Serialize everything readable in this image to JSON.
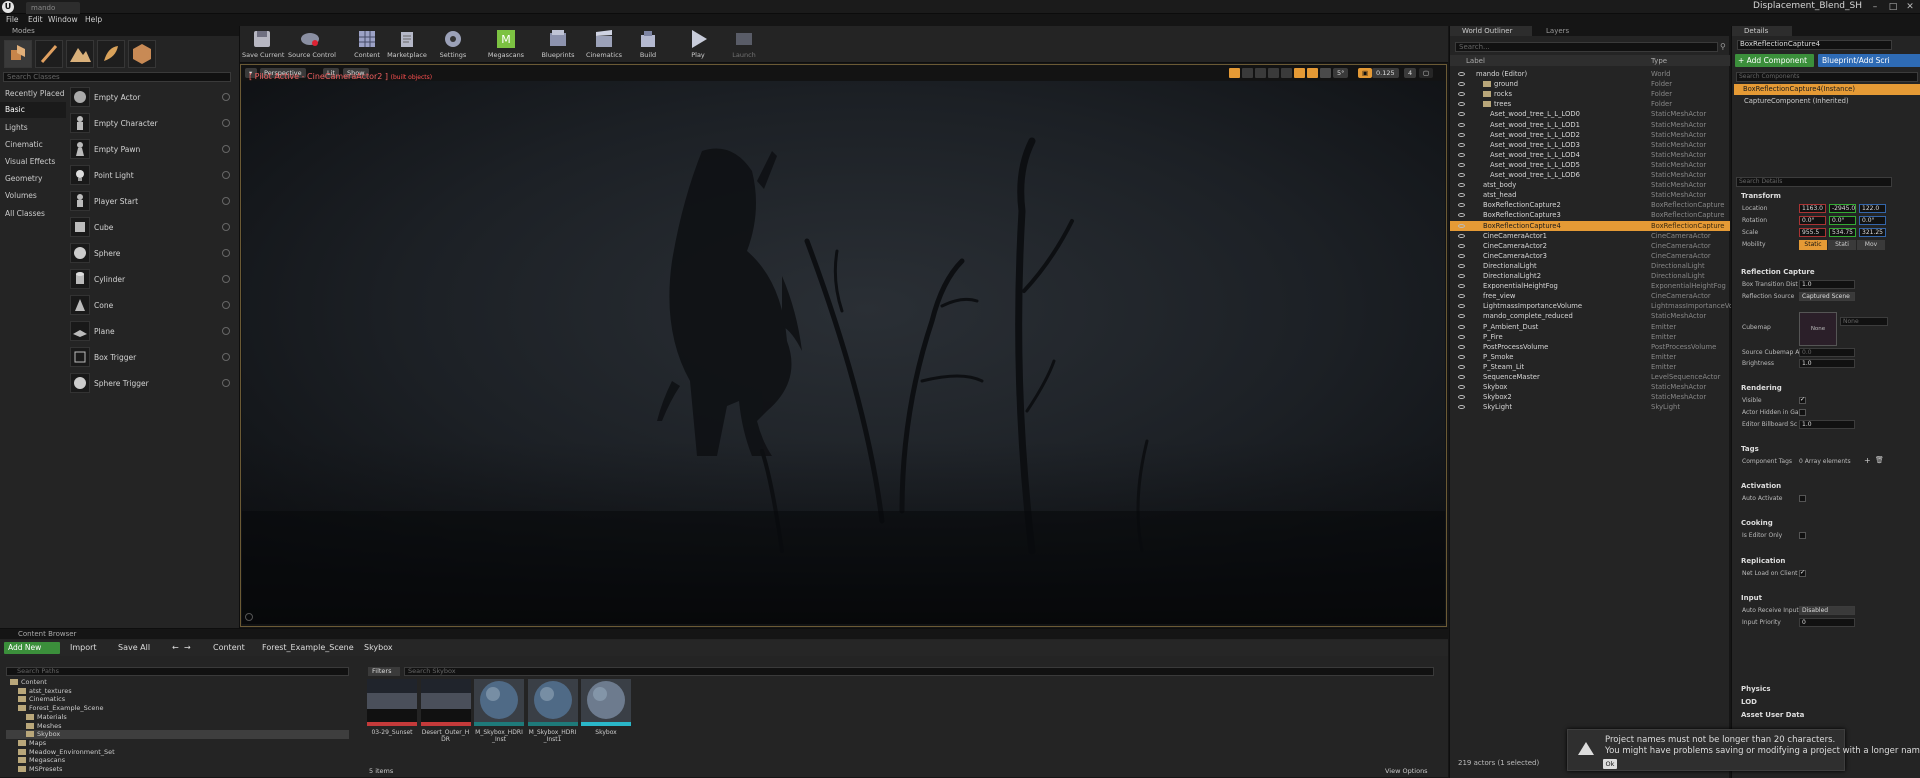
{
  "titlebar": {
    "tab": "mando",
    "project": "Displacement_Blend_SH",
    "min": "–",
    "max": "□",
    "close": "✕"
  },
  "menu": [
    "File",
    "Edit",
    "Window",
    "Help"
  ],
  "modes": {
    "tab": "Modes",
    "search_placeholder": "Search Classes",
    "categories": [
      "Recently Placed",
      "Basic",
      "Lights",
      "Cinematic",
      "Visual Effects",
      "Geometry",
      "Volumes",
      "All Classes"
    ],
    "items": [
      "Empty Actor",
      "Empty Character",
      "Empty Pawn",
      "Point Light",
      "Player Start",
      "Cube",
      "Sphere",
      "Cylinder",
      "Cone",
      "Plane",
      "Box Trigger",
      "Sphere Trigger"
    ]
  },
  "toolbar": [
    "Save Current",
    "Source Control",
    "Content",
    "Marketplace",
    "Settings",
    "Megascans",
    "Blueprints",
    "Cinematics",
    "Build",
    "Play",
    "Launch"
  ],
  "viewport": {
    "perspective": "Perspective",
    "lit": "Lit",
    "show": "Show",
    "pilot": "[ Pilot Active - CineCameraActor2 ]",
    "pilot_sub": "(built objects)",
    "grid": "5°",
    "speed": "0.125",
    "cam": "4"
  },
  "outliner": {
    "tab_outliner": "World Outliner",
    "tab_layers": "Layers",
    "search_placeholder": "Search...",
    "col_label": "Label",
    "col_type": "Type",
    "rows": [
      {
        "label": "mando (Editor)",
        "type": "World",
        "indent": 0,
        "folder": false
      },
      {
        "label": "ground",
        "type": "Folder",
        "indent": 1,
        "folder": true
      },
      {
        "label": "rocks",
        "type": "Folder",
        "indent": 1,
        "folder": true
      },
      {
        "label": "trees",
        "type": "Folder",
        "indent": 1,
        "folder": true
      },
      {
        "label": "Aset_wood_tree_L_L_LOD0",
        "type": "StaticMeshActor",
        "indent": 2,
        "folder": false
      },
      {
        "label": "Aset_wood_tree_L_L_LOD1",
        "type": "StaticMeshActor",
        "indent": 2,
        "folder": false
      },
      {
        "label": "Aset_wood_tree_L_L_LOD2",
        "type": "StaticMeshActor",
        "indent": 2,
        "folder": false
      },
      {
        "label": "Aset_wood_tree_L_L_LOD3",
        "type": "StaticMeshActor",
        "indent": 2,
        "folder": false
      },
      {
        "label": "Aset_wood_tree_L_L_LOD4",
        "type": "StaticMeshActor",
        "indent": 2,
        "folder": false
      },
      {
        "label": "Aset_wood_tree_L_L_LOD5",
        "type": "StaticMeshActor",
        "indent": 2,
        "folder": false
      },
      {
        "label": "Aset_wood_tree_L_L_LOD6",
        "type": "StaticMeshActor",
        "indent": 2,
        "folder": false
      },
      {
        "label": "atst_body",
        "type": "StaticMeshActor",
        "indent": 1,
        "folder": false
      },
      {
        "label": "atst_head",
        "type": "StaticMeshActor",
        "indent": 1,
        "folder": false
      },
      {
        "label": "BoxReflectionCapture2",
        "type": "BoxReflectionCapture",
        "indent": 1,
        "folder": false
      },
      {
        "label": "BoxReflectionCapture3",
        "type": "BoxReflectionCapture",
        "indent": 1,
        "folder": false
      },
      {
        "label": "BoxReflectionCapture4",
        "type": "BoxReflectionCapture",
        "indent": 1,
        "folder": false,
        "selected": true
      },
      {
        "label": "CineCameraActor1",
        "type": "CineCameraActor",
        "indent": 1,
        "folder": false
      },
      {
        "label": "CineCameraActor2",
        "type": "CineCameraActor",
        "indent": 1,
        "folder": false
      },
      {
        "label": "CineCameraActor3",
        "type": "CineCameraActor",
        "indent": 1,
        "folder": false
      },
      {
        "label": "DirectionalLight",
        "type": "DirectionalLight",
        "indent": 1,
        "folder": false
      },
      {
        "label": "DirectionalLight2",
        "type": "DirectionalLight",
        "indent": 1,
        "folder": false
      },
      {
        "label": "ExponentialHeightFog",
        "type": "ExponentialHeightFog",
        "indent": 1,
        "folder": false
      },
      {
        "label": "free_view",
        "type": "CineCameraActor",
        "indent": 1,
        "folder": false
      },
      {
        "label": "LightmassImportanceVolume",
        "type": "LightmassImportanceVo",
        "indent": 1,
        "folder": false
      },
      {
        "label": "mando_complete_reduced",
        "type": "StaticMeshActor",
        "indent": 1,
        "folder": false
      },
      {
        "label": "P_Ambient_Dust",
        "type": "Emitter",
        "indent": 1,
        "folder": false
      },
      {
        "label": "P_Fire",
        "type": "Emitter",
        "indent": 1,
        "folder": false
      },
      {
        "label": "PostProcessVolume",
        "type": "PostProcessVolume",
        "indent": 1,
        "folder": false
      },
      {
        "label": "P_Smoke",
        "type": "Emitter",
        "indent": 1,
        "folder": false
      },
      {
        "label": "P_Steam_Lit",
        "type": "Emitter",
        "indent": 1,
        "folder": false
      },
      {
        "label": "SequenceMaster",
        "type": "LevelSequenceActor",
        "indent": 1,
        "folder": false
      },
      {
        "label": "Skybox",
        "type": "StaticMeshActor",
        "indent": 1,
        "folder": false
      },
      {
        "label": "Skybox2",
        "type": "StaticMeshActor",
        "indent": 1,
        "folder": false
      },
      {
        "label": "SkyLight",
        "type": "SkyLight",
        "indent": 1,
        "folder": false
      }
    ],
    "footer": "219 actors (1 selected)",
    "view_options": "View Options"
  },
  "details": {
    "tab": "Details",
    "name": "BoxReflectionCapture4",
    "add_component": "+ Add Component",
    "blueprint": "Blueprint/Add Scri",
    "search_components": "Search Components",
    "instance": "BoxReflectionCapture4(Instance)",
    "component": "CaptureComponent (Inherited)",
    "search_details": "Search Details",
    "transform": "Transform",
    "location_label": "Location",
    "location": [
      "1163.0",
      "-2945.0",
      "122.0"
    ],
    "rotation_label": "Rotation",
    "rotation": [
      "0.0°",
      "0.0°",
      "0.0°"
    ],
    "scale_label": "Scale",
    "scale": [
      "955.5",
      "534.75",
      "321.25"
    ],
    "mobility_label": "Mobility",
    "mobility": [
      "Static",
      "Stati",
      "Mov"
    ],
    "reflection_capture": "Reflection Capture",
    "box_transition_label": "Box Transition Dist",
    "box_transition": "1.0",
    "reflection_source_label": "Reflection Source",
    "reflection_source": "Captured Scene",
    "cubemap_label": "Cubemap",
    "cubemap_none": "None",
    "cubemap_field": "None",
    "source_cubemap_label": "Source Cubemap A",
    "source_cubemap": "0.0",
    "brightness_label": "Brightness",
    "brightness": "1.0",
    "rendering": "Rendering",
    "visible_label": "Visible",
    "actor_hidden_label": "Actor Hidden in Ga",
    "billboard_label": "Editor Billboard Sc",
    "billboard": "1.0",
    "tags": "Tags",
    "component_tags_label": "Component Tags",
    "component_tags": "0 Array elements",
    "activation": "Activation",
    "auto_activate_label": "Auto Activate",
    "cooking": "Cooking",
    "editor_only_label": "Is Editor Only",
    "replication": "Replication",
    "net_load_label": "Net Load on Client",
    "input": "Input",
    "auto_receive_label": "Auto Receive Input",
    "auto_receive": "Disabled",
    "input_priority_label": "Input Priority",
    "input_priority": "0",
    "physics": "Physics",
    "lod": "LOD",
    "asset_user_data": "Asset User Data"
  },
  "content_browser": {
    "tab": "Content Browser",
    "add_new": "Add New",
    "import": "Import",
    "save_all": "Save All",
    "breadcrumb": [
      "Content",
      "Forest_Example_Scene",
      "Skybox"
    ],
    "search_paths": "Search Paths",
    "filters": "Filters",
    "search_assets": "Search Skybox",
    "tree": [
      {
        "label": "Content",
        "indent": 0
      },
      {
        "label": "atst_textures",
        "indent": 1
      },
      {
        "label": "Cinematics",
        "indent": 1
      },
      {
        "label": "Forest_Example_Scene",
        "indent": 1
      },
      {
        "label": "Materials",
        "indent": 2
      },
      {
        "label": "Meshes",
        "indent": 2
      },
      {
        "label": "Skybox",
        "indent": 2,
        "selected": true
      },
      {
        "label": "Maps",
        "indent": 1
      },
      {
        "label": "Meadow_Environment_Set",
        "indent": 1
      },
      {
        "label": "Megascans",
        "indent": 1
      },
      {
        "label": "MSPresets",
        "indent": 1
      }
    ],
    "assets": [
      {
        "name": "03-29_Sunset",
        "kind": "sunset",
        "bar": "#c43a3a"
      },
      {
        "name": "Desert_Outer_HDR",
        "kind": "sunset",
        "bar": "#c43a3a"
      },
      {
        "name": "M_Skybox_HDRI_Inst",
        "kind": "sphere",
        "bar": "#1e7a7a"
      },
      {
        "name": "M_Skybox_HDRI_Inst1",
        "kind": "sphere",
        "bar": "#1e7a7a"
      },
      {
        "name": "Skybox",
        "kind": "sphere2",
        "bar": "#2ab7c9"
      }
    ],
    "count": "5 items"
  },
  "toast": {
    "line1": "Project names must not be longer than 20 characters.",
    "line2": "You might have problems saving or modifying a project with a longer name.",
    "ok": "Ok"
  },
  "colors": {
    "accent": "#e59a35",
    "add_green": "#3b8f3b",
    "blueprint_blue": "#2e6bb5"
  }
}
